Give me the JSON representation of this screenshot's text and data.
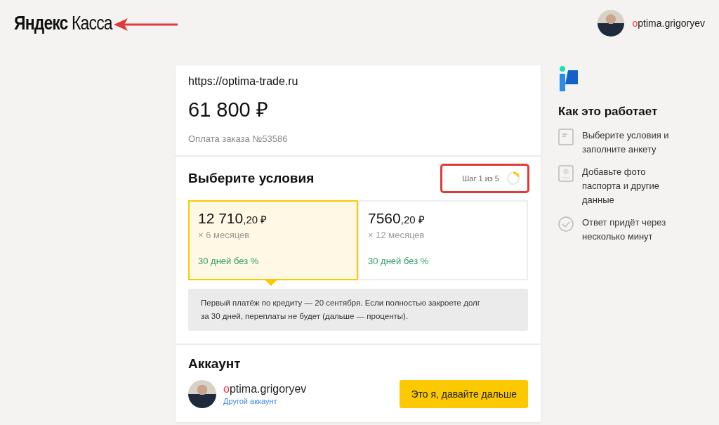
{
  "header": {
    "logo": {
      "bold": "Яндекс",
      "light": "Касса"
    },
    "user": {
      "accent": "o",
      "rest": "ptima.grigoryev"
    }
  },
  "annotations": {
    "logo_arrow": true,
    "step_frame": true
  },
  "order": {
    "site": "https://optima-trade.ru",
    "amount": "61 800 ₽",
    "description": "Оплата заказа №53586"
  },
  "terms": {
    "title": "Выберите условия",
    "step": {
      "label": "Шаг 1 из 5",
      "level": 0.2
    },
    "plans": [
      {
        "whole": "12 710",
        "cents": ",20 ₽",
        "term": "× 6 месяцев",
        "promo": "30 дней без %",
        "selected": true
      },
      {
        "whole": "7560",
        "cents": ",20 ₽",
        "term": "× 12 месяцев",
        "promo": "30 дней без %",
        "selected": false
      }
    ],
    "note": "Первый платёж по кредиту — 20 сентября. Если полностью закроете долг за 30 дней, переплаты не будет (дальше — проценты)."
  },
  "account": {
    "title": "Аккаунт",
    "user": {
      "accent": "o",
      "rest": "ptima.grigoryev"
    },
    "switch_link": "Другой аккаунт",
    "confirm_button": "Это я, давайте дальше"
  },
  "how_it_works": {
    "title": "Как это работает",
    "steps": [
      {
        "kind": "form",
        "text": "Выберите условия и заполните анкету"
      },
      {
        "kind": "passport",
        "text": "Добавьте фото паспорта и другие данные"
      },
      {
        "kind": "check",
        "text": "Ответ придёт через несколько минут"
      }
    ]
  }
}
